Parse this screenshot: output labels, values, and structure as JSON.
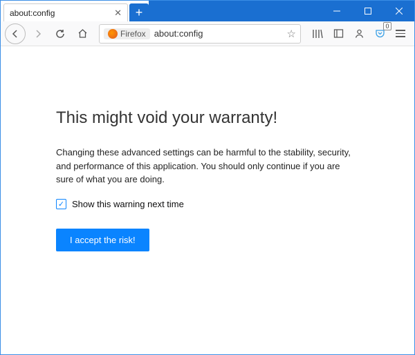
{
  "tab": {
    "title": "about:config"
  },
  "urlbar": {
    "brand": "Firefox",
    "url": "about:config"
  },
  "toolbar": {
    "pocket_badge": "0"
  },
  "warning": {
    "heading": "This might void your warranty!",
    "body": "Changing these advanced settings can be harmful to the stability, security, and performance of this application. You should only continue if you are sure of what you are doing.",
    "checkbox_label": "Show this warning next time",
    "accept_button": "I accept the risk!"
  }
}
